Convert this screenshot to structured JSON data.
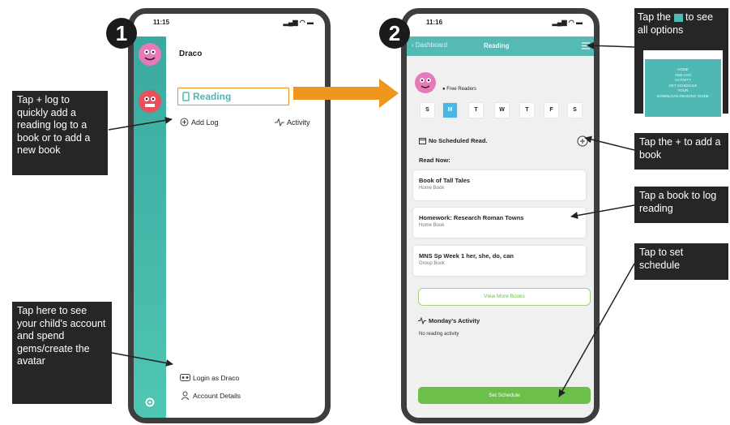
{
  "phone1": {
    "badge": "1",
    "time": "11:15",
    "signal": "▂▄▆ ◠ ▬",
    "child_name": "Draco",
    "avatars": [
      "",
      ""
    ],
    "reading_label": "Reading",
    "add_log_label": "Add Log",
    "activity_label": "Activity",
    "login_label": "Login as Draco",
    "account_label": "Account Details"
  },
  "phone2": {
    "badge": "2",
    "time": "11:16",
    "signal": "▂▄▆ ◠ ▬",
    "back_label": "Dashboard",
    "title": "Reading",
    "reader_label": "Free Readers",
    "days": [
      "S",
      "M",
      "T",
      "W",
      "T",
      "F",
      "S"
    ],
    "schedule_label": "No Scheduled Read.",
    "read_now_label": "Read Now:",
    "books": [
      {
        "title": "Book of Tall Tales",
        "sub": "Home Book"
      },
      {
        "title": "Homework: Research Roman Towns",
        "sub": "Home Book"
      },
      {
        "title": "MNS Sp Week 1 her, she, do, can",
        "sub": "Group Book"
      }
    ],
    "view_more": "View More Books",
    "activity_title": "Monday's Activity",
    "activity_text": "No reading activity",
    "set_schedule": "Set Schedule"
  },
  "callouts": {
    "tap_log": "Tap + log to quickly add a reading log to a book or to add a new book",
    "tap_account": "Tap here to see your child's account and spend gems/create the avatar",
    "tap_options_a": "Tap the",
    "tap_options_b": "to see all options",
    "tap_plus": "Tap the + to add a book",
    "tap_book": "Tap a book to log reading",
    "tap_schedule": "Tap to set schedule"
  },
  "menu_preview": [
    "HOME",
    "ADD LOG",
    "ACTIVITY",
    "SET SCHEDULE",
    "TOUR",
    "DOWNLOAD READING GUIDE"
  ],
  "colors": {
    "teal": "#4fb8b2",
    "green": "#6cc04a",
    "orange": "#f0961f",
    "callout": "#262626",
    "pink": "#e879b8",
    "red": "#e8505b"
  },
  "icons": [
    "book-icon",
    "plus-circle-icon",
    "activity-icon",
    "login-icon",
    "user-icon",
    "gear-icon",
    "calendar-icon",
    "menu-icon",
    "chevron-left-icon"
  ]
}
